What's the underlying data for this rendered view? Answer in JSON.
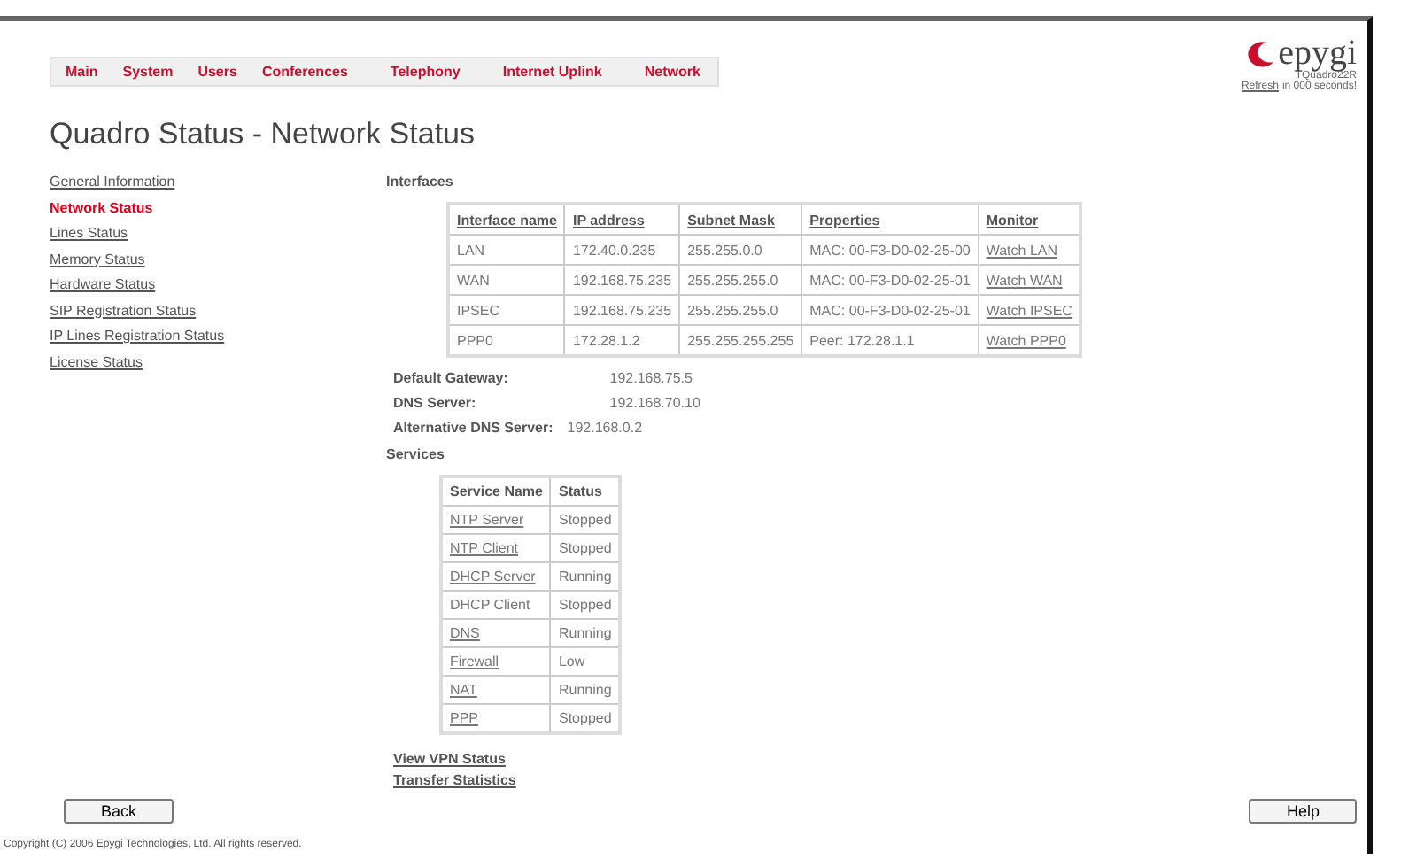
{
  "nav": [
    {
      "label": "Main"
    },
    {
      "label": "System"
    },
    {
      "label": "Users"
    },
    {
      "label": "Conferences"
    },
    {
      "label": "Telephony"
    },
    {
      "label": "Internet Uplink"
    },
    {
      "label": "Network"
    }
  ],
  "logo": {
    "brand": "epygi",
    "model": "TQuadro22R",
    "refresh_link": "Refresh",
    "refresh_text": "in 000 seconds!"
  },
  "title": "Quadro Status - Network Status",
  "sidebar": {
    "items": [
      {
        "label": "General Information",
        "selected": false
      },
      {
        "label": "Network Status",
        "selected": true
      },
      {
        "label": "Lines Status",
        "selected": false
      },
      {
        "label": "Memory Status",
        "selected": false
      },
      {
        "label": "Hardware Status",
        "selected": false
      },
      {
        "label": "SIP Registration Status",
        "selected": false
      },
      {
        "label": "IP Lines Registration Status",
        "selected": false
      },
      {
        "label": "License Status",
        "selected": false
      }
    ]
  },
  "interfaces": {
    "heading": "Interfaces",
    "columns": [
      {
        "label": "Interface name",
        "link": true
      },
      {
        "label": "IP address",
        "link": true
      },
      {
        "label": "Subnet Mask",
        "link": true
      },
      {
        "label": "Properties",
        "link": true
      },
      {
        "label": "Monitor",
        "link": true
      }
    ],
    "rows": [
      [
        {
          "text": "LAN",
          "link": false
        },
        {
          "text": "172.40.0.235",
          "link": false
        },
        {
          "text": "255.255.0.0",
          "link": false
        },
        {
          "text": "MAC: 00-F3-D0-02-25-00",
          "link": false
        },
        {
          "text": "Watch LAN",
          "link": true
        }
      ],
      [
        {
          "text": "WAN",
          "link": false
        },
        {
          "text": "192.168.75.235",
          "link": false
        },
        {
          "text": "255.255.255.0",
          "link": false
        },
        {
          "text": "MAC: 00-F3-D0-02-25-01",
          "link": false
        },
        {
          "text": "Watch WAN",
          "link": true
        }
      ],
      [
        {
          "text": "IPSEC",
          "link": false
        },
        {
          "text": "192.168.75.235",
          "link": false
        },
        {
          "text": "255.255.255.0",
          "link": false
        },
        {
          "text": "MAC: 00-F3-D0-02-25-01",
          "link": false
        },
        {
          "text": "Watch IPSEC",
          "link": true
        }
      ],
      [
        {
          "text": "PPP0",
          "link": false
        },
        {
          "text": "172.28.1.2",
          "link": false
        },
        {
          "text": "255.255.255.255",
          "link": false
        },
        {
          "text": "Peer: 172.28.1.1",
          "link": false
        },
        {
          "text": "Watch PPP0",
          "link": true
        }
      ]
    ]
  },
  "network_info": [
    {
      "label": "Default Gateway:",
      "value": "192.168.75.5"
    },
    {
      "label": "DNS Server:",
      "value": "192.168.70.10"
    },
    {
      "label": "Alternative DNS Server:",
      "value": "192.168.0.2"
    }
  ],
  "services": {
    "heading": "Services",
    "columns": [
      {
        "label": "Service Name",
        "link": false
      },
      {
        "label": "Status",
        "link": false
      }
    ],
    "rows": [
      [
        {
          "text": "NTP Server",
          "link": true
        },
        {
          "text": "Stopped",
          "link": false
        }
      ],
      [
        {
          "text": "NTP Client",
          "link": true
        },
        {
          "text": "Stopped",
          "link": false
        }
      ],
      [
        {
          "text": "DHCP Server",
          "link": true
        },
        {
          "text": "Running",
          "link": false
        }
      ],
      [
        {
          "text": "DHCP Client",
          "link": false
        },
        {
          "text": "Stopped",
          "link": false
        }
      ],
      [
        {
          "text": "DNS",
          "link": true
        },
        {
          "text": "Running",
          "link": false
        }
      ],
      [
        {
          "text": "Firewall",
          "link": true
        },
        {
          "text": "Low",
          "link": false
        }
      ],
      [
        {
          "text": "NAT",
          "link": true
        },
        {
          "text": "Running",
          "link": false
        }
      ],
      [
        {
          "text": "PPP",
          "link": true
        },
        {
          "text": "Stopped",
          "link": false
        }
      ]
    ]
  },
  "links": [
    "View VPN Status",
    "Transfer Statistics"
  ],
  "buttons": [
    {
      "label": "Back"
    },
    {
      "label": "Help"
    }
  ],
  "copyright": "Copyright (C) 2006 Epygi Technologies, Ltd. All rights reserved."
}
